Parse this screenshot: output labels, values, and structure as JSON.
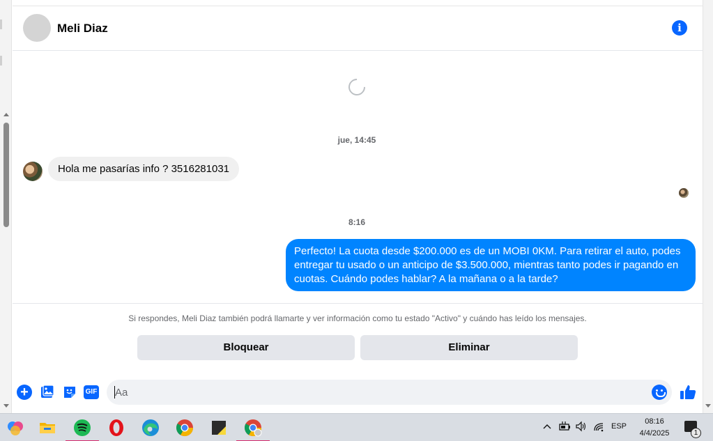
{
  "header": {
    "contact_name": "Meli Diaz"
  },
  "thread": {
    "timestamp_1": "jue, 14:45",
    "incoming_message": "Hola me pasarías info ? 3516281031",
    "timestamp_2": "8:16",
    "outgoing_message": "Perfecto! La cuota desde $200.000 es de un MOBI 0KM. Para retirar el auto, podes entregar tu usado o un anticipo de $3.500.000, mientras tanto podes ir pagando en cuotas. Cuándo podes hablar? A la mañana o a la tarde?"
  },
  "request_notice": {
    "text": "Si respondes, Meli Diaz también podrá llamarte y ver información como tu estado \"Activo\" y cuándo has leído los mensajes.",
    "block_label": "Bloquear",
    "delete_label": "Eliminar"
  },
  "composer": {
    "placeholder": "Aa",
    "gif_label": "GIF"
  },
  "colors": {
    "accent": "#0866ff",
    "outgoing_bubble": "#0084ff",
    "incoming_bubble": "#f0f0f0"
  },
  "taskbar": {
    "apps": [
      "copilot-icon",
      "file-explorer-icon",
      "spotify-icon",
      "opera-icon",
      "edge-icon",
      "chrome-icon",
      "sticky-notes-icon",
      "chrome-profile-icon"
    ],
    "language": "ESP",
    "time": "08:16",
    "date": "4/4/2025",
    "notification_count": "1"
  }
}
